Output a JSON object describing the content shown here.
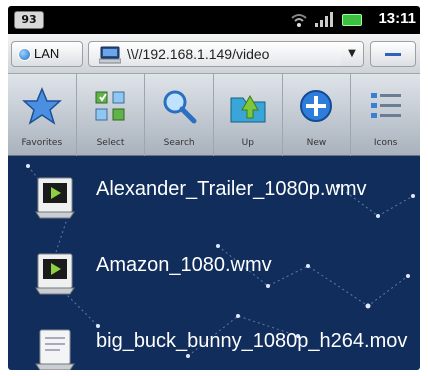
{
  "status_bar": {
    "notification_count": "93",
    "time": "13:11",
    "icons": [
      "wifi-icon",
      "signal-icon",
      "battery-icon"
    ],
    "battery_color": "#3fbf3f"
  },
  "address_bar": {
    "lan_label": "LAN",
    "path": "\\\\//192.168.1.149/video",
    "path_icon": "computer-icon"
  },
  "toolbar": {
    "items": [
      {
        "label": "Favorites",
        "icon": "star-icon"
      },
      {
        "label": "Select",
        "icon": "select-grid-icon"
      },
      {
        "label": "Search",
        "icon": "magnifier-icon"
      },
      {
        "label": "Up",
        "icon": "folder-up-icon"
      },
      {
        "label": "New",
        "icon": "plus-icon"
      },
      {
        "label": "Icons",
        "icon": "list-view-icon"
      }
    ]
  },
  "files": [
    {
      "name": "Alexander_Trailer_1080p.wmv",
      "icon": "video-file-icon"
    },
    {
      "name": "Amazon_1080.wmv",
      "icon": "video-file-icon"
    },
    {
      "name": "big_buck_bunny_1080p_h264.mov",
      "icon": "generic-file-icon"
    }
  ],
  "colors": {
    "list_background": "#102d5c",
    "accent_blue": "#2d63b8"
  }
}
